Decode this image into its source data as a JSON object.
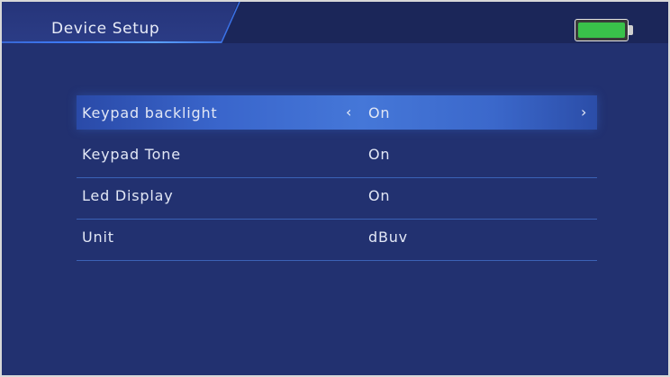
{
  "header": {
    "title": "Device Setup",
    "battery_level": 1.0,
    "battery_color": "#39c14a"
  },
  "menu": {
    "items": [
      {
        "label": "Keypad backlight",
        "value": "On",
        "selected": true
      },
      {
        "label": "Keypad Tone",
        "value": "On",
        "selected": false
      },
      {
        "label": "Led Display",
        "value": "On",
        "selected": false
      },
      {
        "label": "Unit",
        "value": "dBuv",
        "selected": false
      }
    ],
    "left_arrow": "‹",
    "right_arrow": "›"
  },
  "colors": {
    "background": "#223170",
    "header": "#1b2659",
    "highlight": "#4577d8",
    "divider": "#3b62b6"
  }
}
